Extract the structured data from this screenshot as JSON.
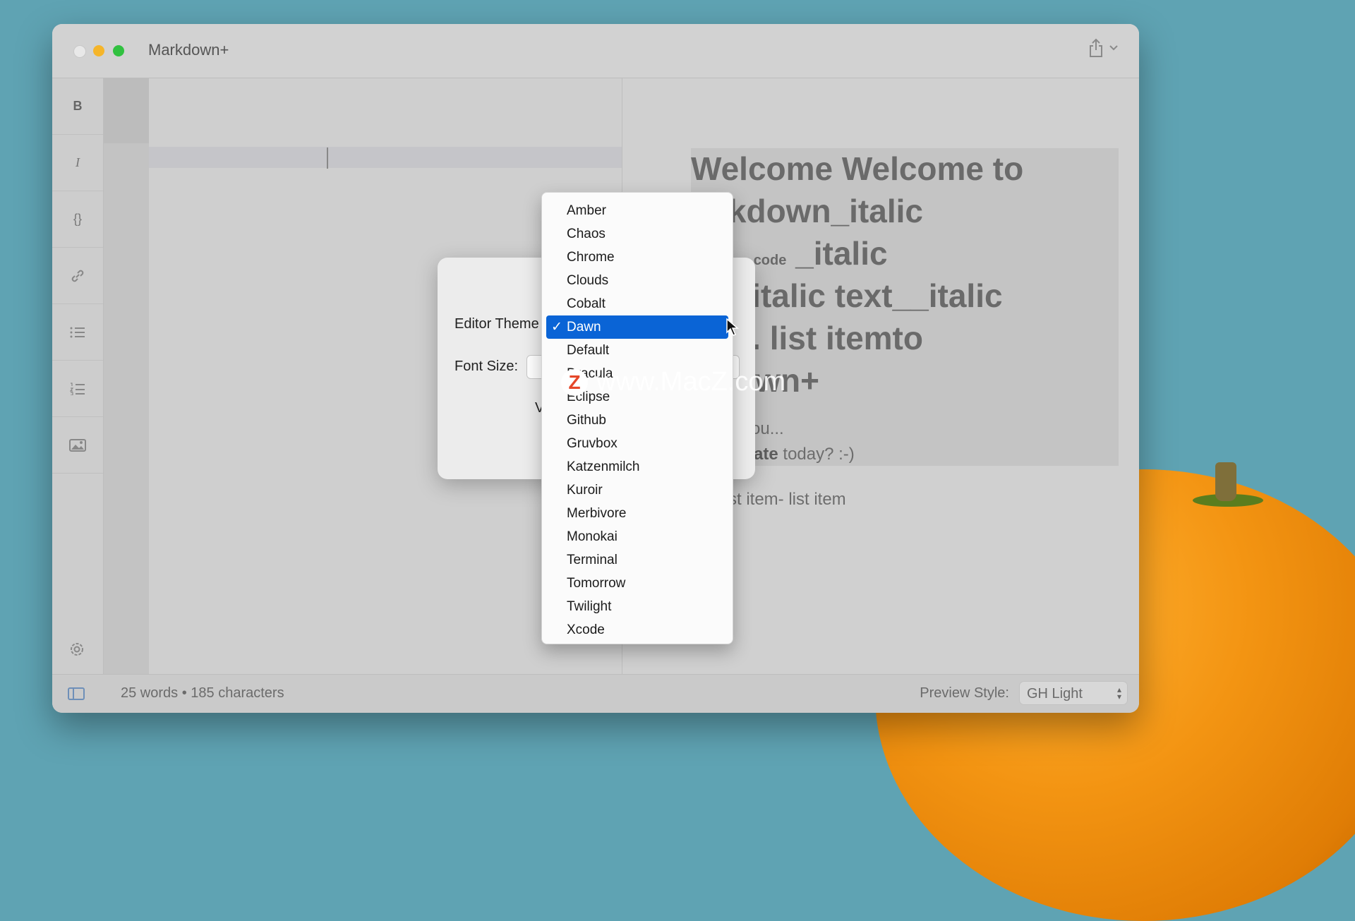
{
  "window": {
    "title": "Markdown+"
  },
  "toolbar": {
    "bold_label": "B",
    "italic_label": "I",
    "code_label": "{}"
  },
  "preview": {
    "heading_lines": [
      "Welcome Welcome to",
      "rkdown_italic",
      "t_",
      "_italic",
      "__italic text__italic",
      "_1. list itemto",
      "down+"
    ],
    "code_inline": "code",
    "para1": "e you...",
    "para2_bold": "create",
    "para2_rest": " today? :-)",
    "list_line": "st item- list item"
  },
  "status": {
    "counts": "25 words • 185 characters",
    "preview_style_label": "Preview Style:",
    "preview_style_value": "GH Light"
  },
  "dialog": {
    "editor_theme_label": "Editor Theme",
    "font_size_label": "Font Size:",
    "fragment": "V"
  },
  "theme_menu": {
    "selected": "Dawn",
    "items": [
      "Amber",
      "Chaos",
      "Chrome",
      "Clouds",
      "Cobalt",
      "Dawn",
      "Default",
      "Dracula",
      "Eclipse",
      "Github",
      "Gruvbox",
      "Katzenmilch",
      "Kuroir",
      "Merbivore",
      "Monokai",
      "Terminal",
      "Tomorrow",
      "Twilight",
      "Xcode"
    ]
  },
  "watermark": {
    "logo": "Z",
    "text": "www.MacZ.com"
  },
  "colors": {
    "selection": "#0a64d6",
    "traffic_min": "#f5b52a",
    "traffic_max": "#31c140"
  }
}
